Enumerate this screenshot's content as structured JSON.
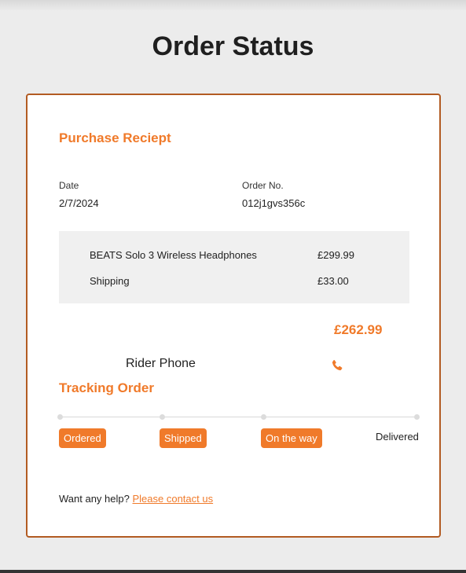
{
  "page": {
    "title": "Order Status"
  },
  "receipt": {
    "heading": "Purchase Reciept",
    "date_label": "Date",
    "date_value": "2/7/2024",
    "order_label": "Order No.",
    "order_value": "012j1gvs356c",
    "items": [
      {
        "name": "BEATS Solo 3 Wireless Headphones",
        "price": "£299.99"
      },
      {
        "name": "Shipping",
        "price": "£33.00"
      }
    ],
    "total": "£262.99",
    "rider_label": "Rider Phone",
    "phone_icon": "phone-icon"
  },
  "tracking": {
    "heading": "Tracking Order",
    "steps": [
      {
        "label": "Ordered",
        "highlighted": true
      },
      {
        "label": "Shipped",
        "highlighted": true
      },
      {
        "label": "On the way",
        "highlighted": true
      },
      {
        "label": "Delivered",
        "highlighted": false
      }
    ]
  },
  "help": {
    "text": "Want any help?",
    "link_text": "Please contact us"
  },
  "colors": {
    "accent": "#f07a2a",
    "border": "#b25b22",
    "background": "#ececec",
    "items_box": "#f0f0f0"
  }
}
